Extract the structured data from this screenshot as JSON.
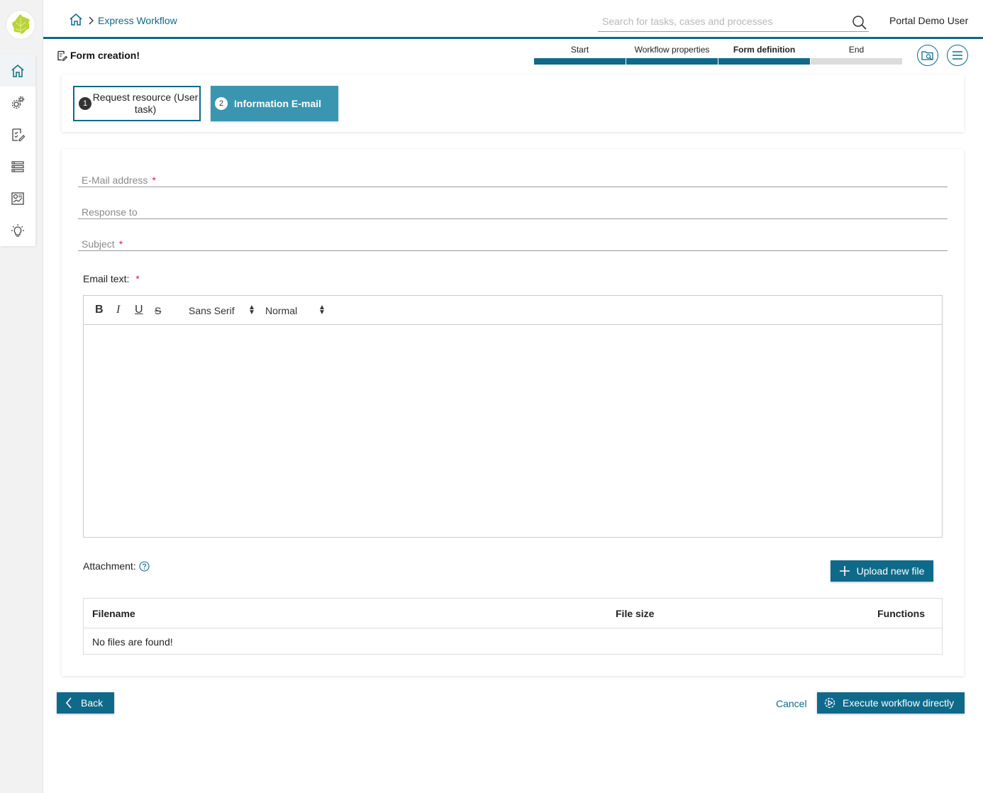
{
  "header": {
    "breadcrumb": "Express Workflow",
    "search_placeholder": "Search for tasks, cases and processes",
    "user": "Portal Demo User"
  },
  "sidebar": {
    "items": [
      {
        "icon": "home-icon"
      },
      {
        "icon": "gears-icon"
      },
      {
        "icon": "task-edit-icon"
      },
      {
        "icon": "list-icon"
      },
      {
        "icon": "statistics-icon"
      },
      {
        "icon": "lightbulb-icon"
      }
    ]
  },
  "page": {
    "title": "Form creation!"
  },
  "wizard": {
    "steps": [
      {
        "label": "Start",
        "state": "done"
      },
      {
        "label": "Workflow properties",
        "state": "done"
      },
      {
        "label": "Form definition",
        "state": "current"
      },
      {
        "label": "End",
        "state": "todo"
      }
    ]
  },
  "tasks": [
    {
      "number": "1",
      "label": "Request resource (User task)"
    },
    {
      "number": "2",
      "label": "Information E-mail"
    }
  ],
  "form": {
    "email_label": "E-Mail address",
    "response_label": "Response to",
    "subject_label": "Subject",
    "required_mark": "*",
    "email_text_label": "Email text:",
    "editor": {
      "bold": "B",
      "italic": "I",
      "underline": "U",
      "strike": "S",
      "font": "Sans Serif",
      "size": "Normal"
    },
    "attachment_label": "Attachment:",
    "upload_button": "Upload new file",
    "table": {
      "headers": {
        "filename": "Filename",
        "size": "File size",
        "functions": "Functions"
      },
      "empty": "No files are found!"
    }
  },
  "footer": {
    "back": "Back",
    "cancel": "Cancel",
    "execute": "Execute workflow directly"
  },
  "colors": {
    "primary": "#0f6a8a",
    "task_active": "#3a96b0",
    "required": "#d9204c"
  }
}
